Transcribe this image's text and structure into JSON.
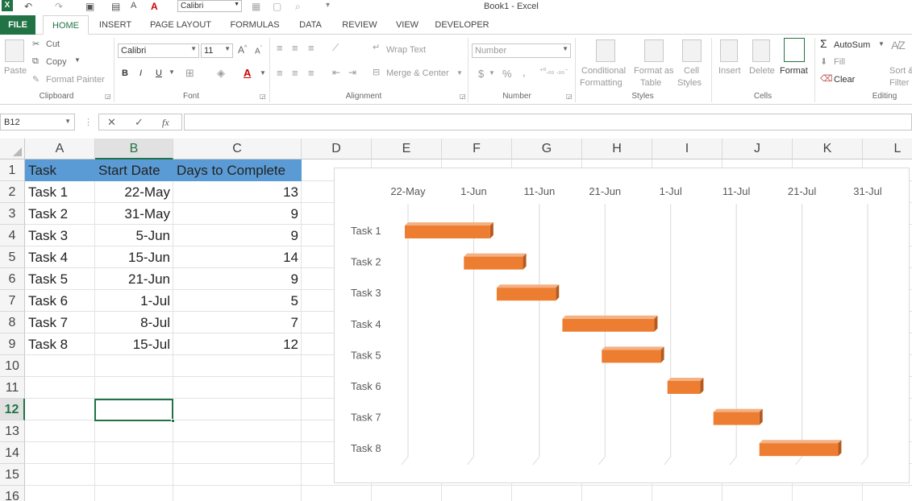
{
  "window": {
    "title": "Book1 - Excel"
  },
  "quick_access": {
    "font_name": "Calibri"
  },
  "tabs": [
    "FILE",
    "HOME",
    "INSERT",
    "PAGE LAYOUT",
    "FORMULAS",
    "DATA",
    "REVIEW",
    "VIEW",
    "DEVELOPER"
  ],
  "ribbon": {
    "clipboard": {
      "paste": "Paste",
      "cut": "Cut",
      "copy": "Copy",
      "format_painter": "Format Painter",
      "label": "Clipboard"
    },
    "font": {
      "name": "Calibri",
      "size": "11",
      "bold": "B",
      "italic": "I",
      "underline": "U",
      "label": "Font"
    },
    "alignment": {
      "wrap_text": "Wrap Text",
      "merge_center": "Merge & Center",
      "label": "Alignment"
    },
    "number": {
      "format": "Number",
      "currency": "$",
      "percent": "%",
      "comma": ",",
      "label": "Number"
    },
    "styles": {
      "conditional_1": "Conditional",
      "conditional_2": "Formatting",
      "format_as_1": "Format as",
      "format_as_2": "Table",
      "cell_1": "Cell",
      "cell_2": "Styles",
      "label": "Styles"
    },
    "cells": {
      "insert": "Insert",
      "delete": "Delete",
      "format": "Format",
      "label": "Cells"
    },
    "editing": {
      "autosum": "AutoSum",
      "fill": "Fill",
      "clear": "Clear",
      "sort_1": "Sort &",
      "sort_2": "Filter",
      "label": "Editing"
    }
  },
  "formula_bar": {
    "name_box": "B12",
    "fx": "fx",
    "cancel": "✕",
    "enter": "✓",
    "formula": ""
  },
  "sheet": {
    "columns": [
      "A",
      "B",
      "C",
      "D",
      "E",
      "F",
      "G",
      "H",
      "I",
      "J",
      "K",
      "L"
    ],
    "rows": [
      "1",
      "2",
      "3",
      "4",
      "5",
      "6",
      "7",
      "8",
      "9",
      "10",
      "11",
      "12",
      "13",
      "14",
      "15",
      "16"
    ],
    "selected_cell": "B12",
    "header": [
      "Task",
      "Start Date",
      "Days to Complete"
    ],
    "data": [
      [
        "Task 1",
        "22-May",
        "13"
      ],
      [
        "Task 2",
        "31-May",
        "9"
      ],
      [
        "Task 3",
        "5-Jun",
        "9"
      ],
      [
        "Task 4",
        "15-Jun",
        "14"
      ],
      [
        "Task 5",
        "21-Jun",
        "9"
      ],
      [
        "Task 6",
        "1-Jul",
        "5"
      ],
      [
        "Task 7",
        "8-Jul",
        "7"
      ],
      [
        "Task 8",
        "15-Jul",
        "12"
      ]
    ]
  },
  "chart_data": {
    "type": "bar",
    "orientation": "horizontal-stacked-gantt",
    "categories": [
      "Task 1",
      "Task 2",
      "Task 3",
      "Task 4",
      "Task 5",
      "Task 6",
      "Task 7",
      "Task 8"
    ],
    "start_dates": [
      "22-May",
      "31-May",
      "5-Jun",
      "15-Jun",
      "21-Jun",
      "1-Jul",
      "8-Jul",
      "15-Jul"
    ],
    "durations": [
      13,
      9,
      9,
      14,
      9,
      5,
      7,
      12
    ],
    "x_tick_labels": [
      "22-May",
      "1-Jun",
      "11-Jun",
      "21-Jun",
      "1-Jul",
      "11-Jul",
      "21-Jul",
      "31-Jul"
    ],
    "x_axis_position": "top",
    "bar_color": "#ed7d31",
    "grid": true,
    "legend": "none"
  }
}
